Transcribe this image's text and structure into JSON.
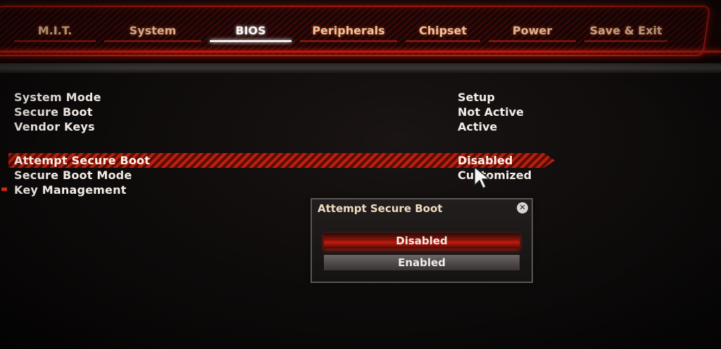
{
  "tabs": [
    {
      "label": "M.I.T."
    },
    {
      "label": "System"
    },
    {
      "label": "BIOS"
    },
    {
      "label": "Peripherals"
    },
    {
      "label": "Chipset"
    },
    {
      "label": "Power"
    },
    {
      "label": "Save & Exit"
    }
  ],
  "active_tab": "BIOS",
  "settings": [
    {
      "label": "System Mode",
      "value": "Setup"
    },
    {
      "label": "Secure Boot",
      "value": "Not Active"
    },
    {
      "label": "Vendor Keys",
      "value": "Active"
    },
    {
      "label": "Attempt Secure Boot",
      "value": "Disabled"
    },
    {
      "label": "Secure Boot Mode",
      "value": "Customized"
    },
    {
      "label": "Key Management",
      "value": ""
    }
  ],
  "popup": {
    "title": "Attempt Secure Boot",
    "close_icon": "close-icon",
    "options": [
      {
        "label": "Disabled",
        "selected": true
      },
      {
        "label": "Enabled",
        "selected": false
      }
    ]
  },
  "colors": {
    "accent": "#c0180c",
    "text": "#f3ece6",
    "background": "#0d0a0a"
  }
}
